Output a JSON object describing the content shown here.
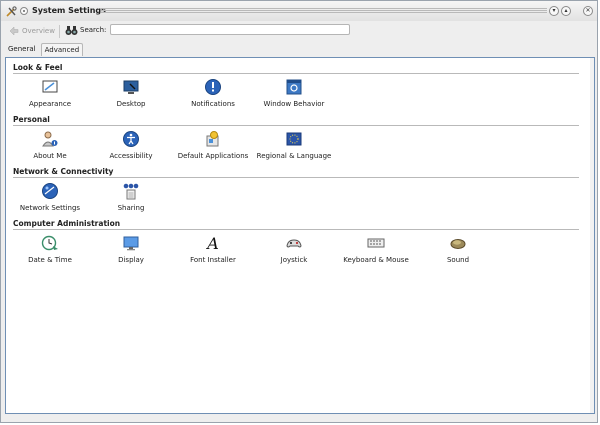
{
  "window": {
    "title": "System Settings"
  },
  "toolbar": {
    "overview_label": "Overview",
    "search_label": "Search:",
    "search_value": ""
  },
  "tabs": [
    {
      "label": "General",
      "active": false
    },
    {
      "label": "Advanced",
      "active": true
    }
  ],
  "categories": [
    {
      "title": "Look & Feel",
      "items": [
        {
          "label": "Appearance",
          "icon": "appearance-icon"
        },
        {
          "label": "Desktop",
          "icon": "desktop-icon"
        },
        {
          "label": "Notifications",
          "icon": "notifications-icon"
        },
        {
          "label": "Window Behavior",
          "icon": "window-behavior-icon"
        }
      ]
    },
    {
      "title": "Personal",
      "items": [
        {
          "label": "About Me",
          "icon": "about-me-icon"
        },
        {
          "label": "Accessibility",
          "icon": "accessibility-icon"
        },
        {
          "label": "Default Applications",
          "icon": "default-applications-icon"
        },
        {
          "label": "Regional & Language",
          "icon": "regional-language-icon"
        }
      ]
    },
    {
      "title": "Network & Connectivity",
      "items": [
        {
          "label": "Network Settings",
          "icon": "network-settings-icon"
        },
        {
          "label": "Sharing",
          "icon": "sharing-icon"
        }
      ]
    },
    {
      "title": "Computer Administration",
      "items": [
        {
          "label": "Date & Time",
          "icon": "date-time-icon"
        },
        {
          "label": "Display",
          "icon": "display-icon"
        },
        {
          "label": "Font Installer",
          "icon": "font-installer-icon"
        },
        {
          "label": "Joystick",
          "icon": "joystick-icon"
        },
        {
          "label": "Keyboard & Mouse",
          "icon": "keyboard-mouse-icon"
        },
        {
          "label": "Sound",
          "icon": "sound-icon"
        }
      ]
    }
  ]
}
